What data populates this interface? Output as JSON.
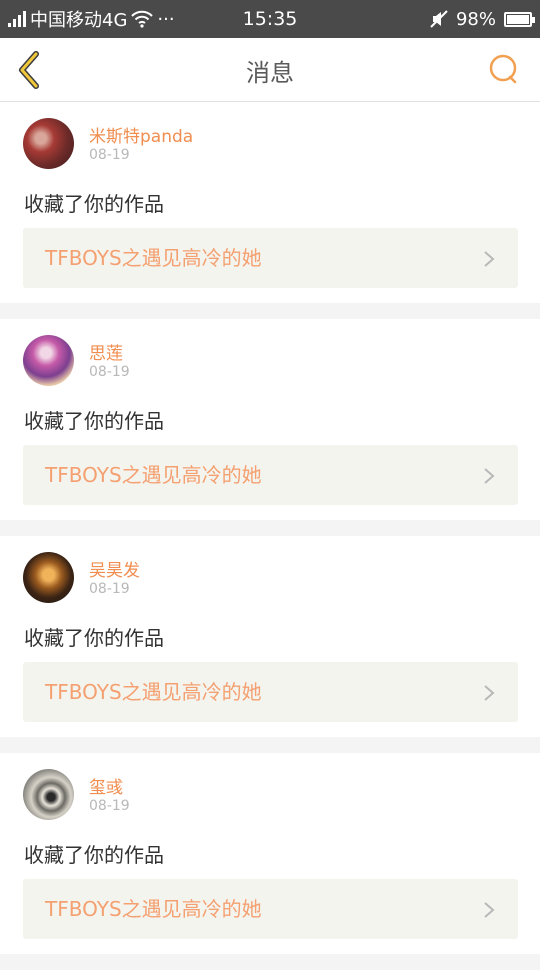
{
  "status_bar": {
    "carrier": "中国移动4G",
    "more": "···",
    "time": "15:35",
    "battery_text": "98%",
    "battery_level": 0.98
  },
  "nav": {
    "title": "消息",
    "back_icon": "chevron-left-icon",
    "search_icon": "search-icon",
    "accent_color": "#f0a050"
  },
  "messages": [
    {
      "username": "米斯特panda",
      "date": "08-19",
      "action": "收藏了你的作品",
      "work_title": "TFBOYS之遇见高冷的她"
    },
    {
      "username": "思莲",
      "date": "08-19",
      "action": "收藏了你的作品",
      "work_title": "TFBOYS之遇见高冷的她"
    },
    {
      "username": "吴昊发",
      "date": "08-19",
      "action": "收藏了你的作品",
      "work_title": "TFBOYS之遇见高冷的她"
    },
    {
      "username": "玺彧",
      "date": "08-19",
      "action": "收藏了你的作品",
      "work_title": "TFBOYS之遇见高冷的她"
    }
  ],
  "colors": {
    "username": "#f08d4f",
    "work_title": "#f4a070",
    "status_bar_bg": "#4a4a4a"
  }
}
